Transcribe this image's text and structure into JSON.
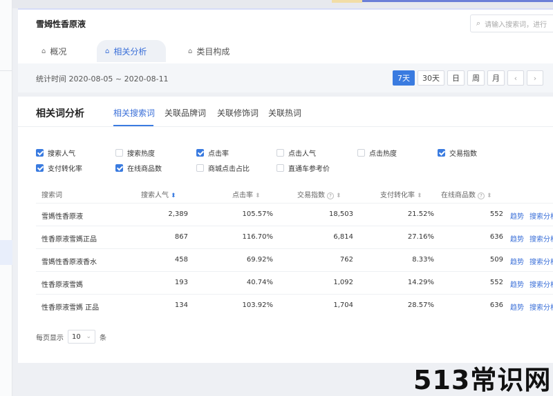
{
  "product": {
    "title": "雪姆性香原液"
  },
  "search": {
    "placeholder": "请输入搜索词，进行"
  },
  "tabs": [
    {
      "label": "概况",
      "icon": "bag-icon"
    },
    {
      "label": "相关分析",
      "icon": "bag-icon"
    },
    {
      "label": "类目构成",
      "icon": "bag-icon"
    }
  ],
  "stats": {
    "range_text": "统计时间 2020-08-05 ~ 2020-08-11",
    "periods": [
      "7天",
      "30天",
      "日",
      "周",
      "月"
    ],
    "active_period": "7天",
    "prev": "‹",
    "next": "›"
  },
  "section": {
    "title": "相关词分析",
    "subtabs": [
      "相关搜索词",
      "关联品牌词",
      "关联修饰词",
      "关联热词"
    ]
  },
  "checkboxes": [
    {
      "label": "搜索人气",
      "checked": true
    },
    {
      "label": "搜索热度",
      "checked": false
    },
    {
      "label": "点击率",
      "checked": true
    },
    {
      "label": "点击人气",
      "checked": false
    },
    {
      "label": "点击热度",
      "checked": false
    },
    {
      "label": "交易指数",
      "checked": true
    },
    {
      "label": "支付转化率",
      "checked": true
    },
    {
      "label": "在线商品数",
      "checked": true
    },
    {
      "label": "商城点击占比",
      "checked": false
    },
    {
      "label": "直通车参考价",
      "checked": false
    }
  ],
  "table": {
    "headers": [
      "搜索词",
      "搜索人气",
      "点击率",
      "交易指数",
      "支付转化率",
      "在线商品数"
    ],
    "rows": [
      {
        "term": "雪媽性香原液",
        "pop": "2,389",
        "ctr": "105.57%",
        "trade": "18,503",
        "conv": "21.52%",
        "items": "552",
        "a1": "趋势",
        "a2": "搜索分析"
      },
      {
        "term": "性香原液雪媽正品",
        "pop": "867",
        "ctr": "116.70%",
        "trade": "6,814",
        "conv": "27.16%",
        "items": "636",
        "a1": "趋势",
        "a2": "搜索分析"
      },
      {
        "term": "雪媽性香原液香水",
        "pop": "458",
        "ctr": "69.92%",
        "trade": "762",
        "conv": "8.33%",
        "items": "509",
        "a1": "趋势",
        "a2": "搜索分析"
      },
      {
        "term": "性香原液雪媽",
        "pop": "193",
        "ctr": "40.74%",
        "trade": "1,092",
        "conv": "14.29%",
        "items": "552",
        "a1": "趋势",
        "a2": "搜索分析"
      },
      {
        "term": "性香原液雪媽 正品",
        "pop": "134",
        "ctr": "103.92%",
        "trade": "1,704",
        "conv": "28.57%",
        "items": "636",
        "a1": "趋势",
        "a2": "搜索分析"
      }
    ]
  },
  "pager": {
    "prefix": "每页显示",
    "value": "10",
    "suffix": "条"
  },
  "watermark": "513常识网",
  "colors": {
    "accent": "#3a7be0",
    "link": "#3a6fd8"
  }
}
